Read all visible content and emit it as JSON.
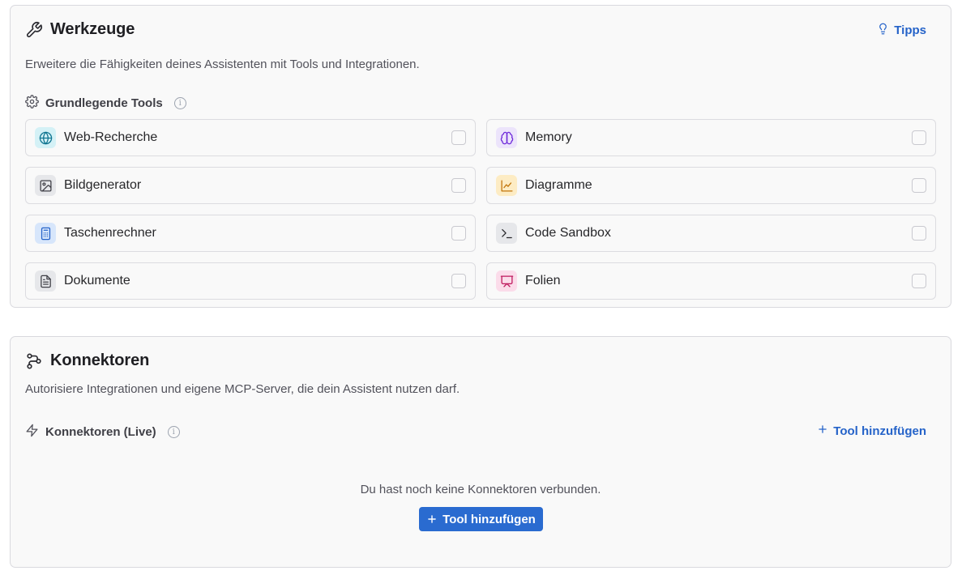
{
  "tools_panel": {
    "title": "Werkzeuge",
    "title_icon": "wrench-icon",
    "tips_label": "Tipps",
    "description": "Erweitere die Fähigkeiten deines Assistenten mit Tools und Integrationen.",
    "section_title": "Grundlegende Tools",
    "tools": [
      {
        "label": "Web-Recherche",
        "icon": "globe-icon",
        "checked": false
      },
      {
        "label": "Memory",
        "icon": "brain-icon",
        "checked": false
      },
      {
        "label": "Bildgenerator",
        "icon": "image-icon",
        "checked": false
      },
      {
        "label": "Diagramme",
        "icon": "chart-icon",
        "checked": false
      },
      {
        "label": "Taschenrechner",
        "icon": "calculator-icon",
        "checked": false
      },
      {
        "label": "Code Sandbox",
        "icon": "terminal-icon",
        "checked": false
      },
      {
        "label": "Dokumente",
        "icon": "document-icon",
        "checked": false
      },
      {
        "label": "Folien",
        "icon": "presentation-icon",
        "checked": false
      }
    ]
  },
  "connectors_panel": {
    "title": "Konnektoren",
    "title_icon": "workflow-icon",
    "description": "Autorisiere Integrationen und eigene MCP-Server, die dein Assistent nutzen darf.",
    "section_title": "Konnektoren (Live)",
    "add_tool_link": "Tool hinzufügen",
    "empty_text": "Du hast noch keine Konnektoren verbunden.",
    "add_tool_button": "Tool hinzufügen"
  },
  "colors": {
    "accent": "#2a6bd0",
    "link": "#2563c9",
    "panel_bg": "#f9f9f9",
    "border": "#d9d9de"
  }
}
